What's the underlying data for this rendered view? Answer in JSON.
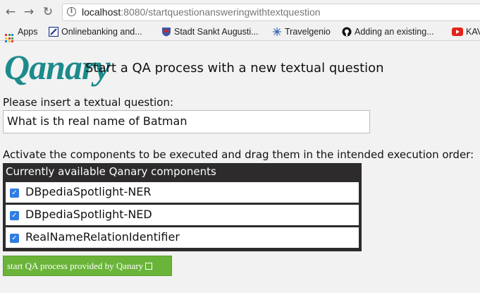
{
  "browser": {
    "url_host": "localhost",
    "url_rest": ":8080/startquestionansweringwithtextquestion",
    "bookmarks": [
      {
        "label": "Apps",
        "icon": "apps-grid-icon"
      },
      {
        "label": "Onlinebanking and...",
        "icon": "bank-icon"
      },
      {
        "label": "Stadt Sankt Augusti...",
        "icon": "crest-icon"
      },
      {
        "label": "Travelgenio",
        "icon": "travel-icon"
      },
      {
        "label": "Adding an existing...",
        "icon": "github-icon"
      },
      {
        "label": "KAV",
        "icon": "youtube-icon"
      }
    ]
  },
  "page": {
    "logo_text": "Qanary",
    "title": "Start a QA process with a new textual question",
    "question_label": "Please insert a textual question:",
    "question_value": "What is th real name of Batman",
    "activate_label": "Activate the components to be executed and drag them in the intended execution order:",
    "components_header": "Currently available Qanary components",
    "components": [
      {
        "name": "DBpediaSpotlight-NER",
        "checked": true
      },
      {
        "name": "DBpediaSpotlight-NED",
        "checked": true
      },
      {
        "name": "RealNameRelationIdentifier",
        "checked": true
      }
    ],
    "start_button": "start QA process provided by Qanary"
  },
  "colors": {
    "button_green": "#6ab43a",
    "components_box": "#2d2b2b",
    "checkbox_blue": "#2f7de1",
    "logo_teal": "#1c8b8c"
  }
}
